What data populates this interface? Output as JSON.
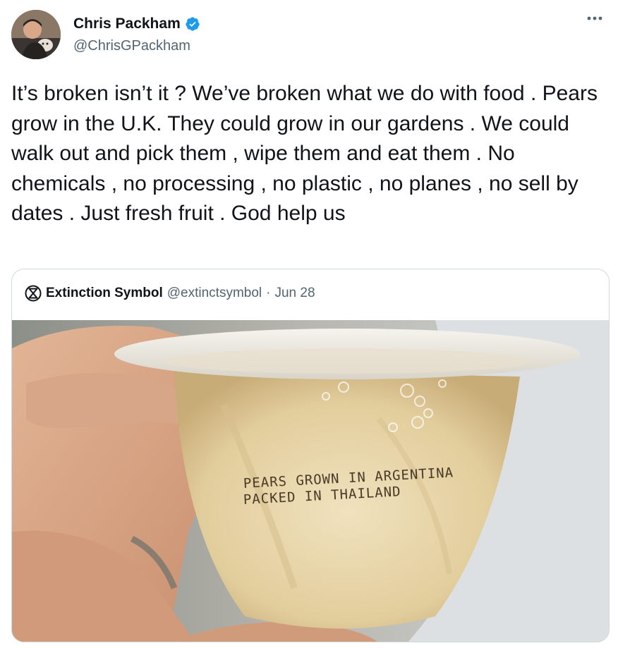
{
  "author": {
    "display_name": "Chris Packham",
    "handle": "@ChrisGPackham",
    "verified": true,
    "verified_color": "#1d9bf0"
  },
  "tweet": {
    "text": "It’s broken isn’t it ? We’ve broken what we do with food . Pears grow in the U.K. They could grow in our gardens . We could walk out and pick them , wipe them and eat them . No chemicals , no processing , no plastic , no planes , no sell by dates . Just fresh fruit . God help us"
  },
  "quoted_tweet": {
    "display_name": "Extinction Symbol",
    "handle": "@extinctsymbol",
    "separator": "·",
    "date": "Jun 28",
    "image": {
      "subject": "pear-cup-photo",
      "label_line_1": "PEARS GROWN IN ARGENTINA",
      "label_line_2": "PACKED IN THAILAND"
    }
  },
  "icons": {
    "more": "more-horizontal-icon",
    "verified": "verified-badge-icon",
    "quote_logo": "extinction-symbol-icon"
  },
  "colors": {
    "text_primary": "#0f1419",
    "text_secondary": "#536471",
    "border": "#cfd9de"
  }
}
